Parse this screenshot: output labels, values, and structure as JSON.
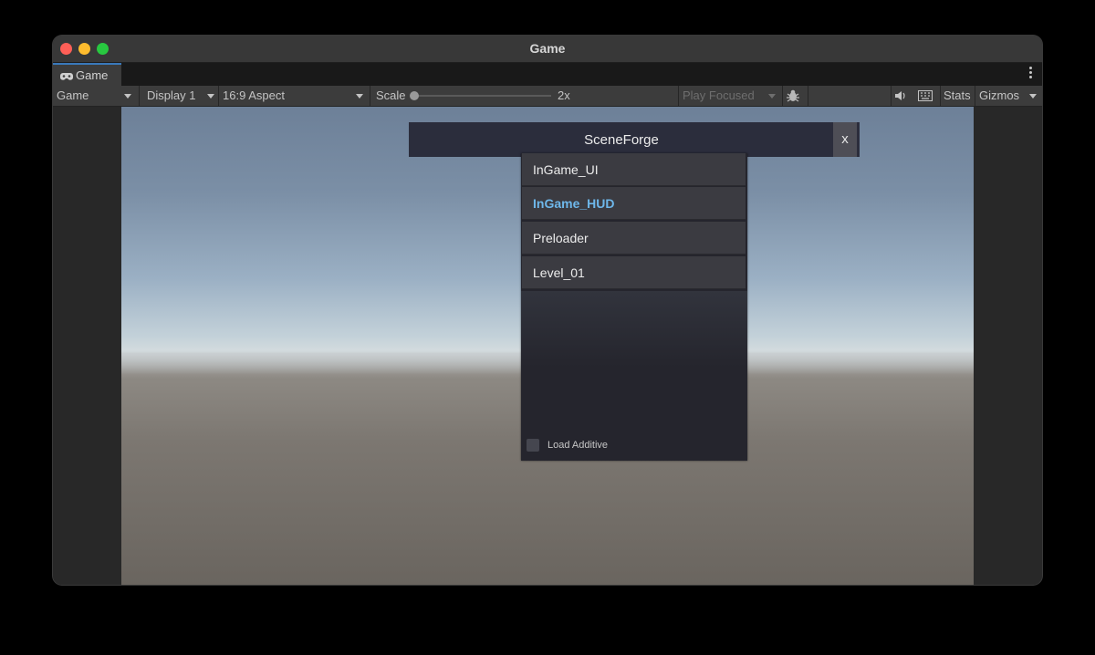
{
  "window": {
    "title": "Game"
  },
  "tabs": [
    {
      "label": "Game",
      "icon": "gamepad-icon"
    }
  ],
  "toolbar": {
    "view_mode": "Game",
    "display": "Display 1",
    "aspect": "16:9 Aspect",
    "scale_label": "Scale",
    "scale_value": "2x",
    "play_mode": "Play Focused",
    "stats": "Stats",
    "gizmos": "Gizmos"
  },
  "scene_forge": {
    "title": "SceneForge",
    "close_label": "x",
    "scenes": [
      {
        "name": "InGame_UI",
        "active": false
      },
      {
        "name": "InGame_HUD",
        "active": true
      },
      {
        "name": "Preloader",
        "active": false
      },
      {
        "name": "Level_01",
        "active": false
      }
    ],
    "load_additive_label": "Load Additive",
    "load_additive_checked": false
  },
  "colors": {
    "accent_tab": "#3a79bb",
    "active_scene": "#6eb7ea",
    "panel_bg": "#25252d",
    "header_bg": "#2b2d3c"
  }
}
